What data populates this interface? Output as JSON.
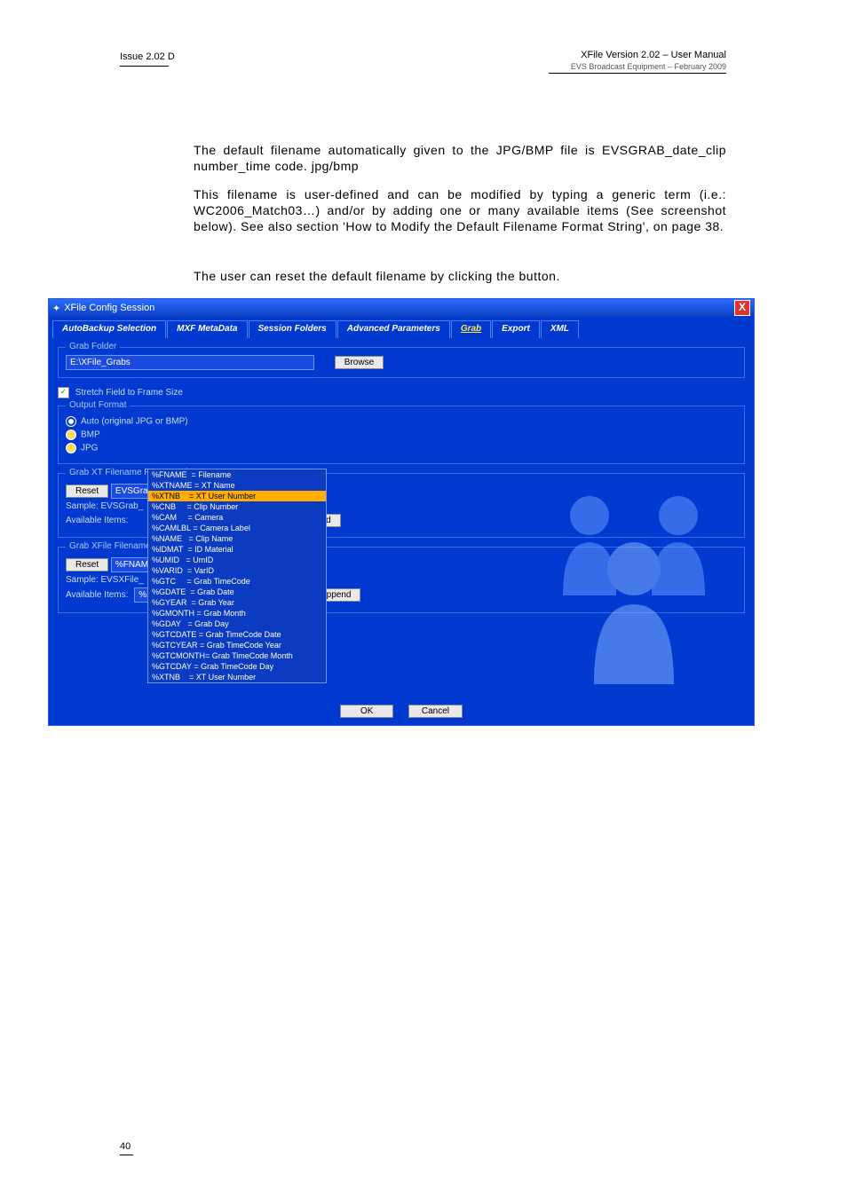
{
  "header": {
    "issue": "Issue 2.02 D",
    "title": "XFile Version 2.02 – User Manual",
    "sub": "EVS Broadcast Equipment – February 2009"
  },
  "para1": "The default filename automatically given to the JPG/BMP file is EVSGRAB_date_clip number_time code. jpg/bmp",
  "para2": "This filename is user-defined and can be modified by typing a generic term (i.e.: WC2006_Match03…) and/or by adding one or many available items (See screenshot below). See also section 'How to Modify the Default Filename Format String', on page 38.",
  "para3": "The user can reset the default filename by clicking the             button.",
  "win": {
    "title": "XFile Config Session",
    "close": "X"
  },
  "tabs": [
    "AutoBackup Selection",
    "MXF MetaData",
    "Session Folders",
    "Advanced Parameters",
    "Grab",
    "Export",
    "XML"
  ],
  "grabFolder": {
    "legend": "Grab Folder",
    "path": "E:\\XFile_Grabs",
    "browse": "Browse"
  },
  "stretch": "Stretch Field to Frame Size",
  "outFmt": {
    "legend": "Output Format",
    "opts": [
      "Auto (original JPG or BMP)",
      "BMP",
      "JPG"
    ]
  },
  "fmt1": {
    "legend": "Grab XT Filename Format String",
    "reset": "Reset",
    "input": "EVSGra",
    "sampleLbl": "Sample: EVSGrab_",
    "availLbl": "Available Items:",
    "append": "Append"
  },
  "fmt2": {
    "legend": "Grab XFile Filename",
    "reset": "Reset",
    "input": "%FNAM",
    "sampleLbl": "Sample: EVSXFile_",
    "availLbl": "Available Items:",
    "sel": "%XTNB",
    "selDesc": "= XT User Number",
    "append": "Append"
  },
  "dropdown": [
    {
      "k": "%FNAME",
      "v": "= Filename"
    },
    {
      "k": "%XTNAME",
      "v": "= XT Name"
    },
    {
      "k": "%XTNB",
      "v": "= XT User Number",
      "hl": true
    },
    {
      "k": "%CNB",
      "v": "= Clip Number"
    },
    {
      "k": "%CAM",
      "v": "= Camera"
    },
    {
      "k": "%CAMLBL",
      "v": "= Camera Label"
    },
    {
      "k": "%NAME",
      "v": "= Clip Name"
    },
    {
      "k": "%IDMAT",
      "v": "= ID Material"
    },
    {
      "k": "%UMID",
      "v": "= UmID"
    },
    {
      "k": "%VARID",
      "v": "= VarID"
    },
    {
      "k": "%GTC",
      "v": "= Grab TimeCode"
    },
    {
      "k": "%GDATE",
      "v": "= Grab Date"
    },
    {
      "k": "%GYEAR",
      "v": "= Grab Year"
    },
    {
      "k": "%GMONTH",
      "v": "= Grab Month"
    },
    {
      "k": "%GDAY",
      "v": "= Grab Day"
    },
    {
      "k": "%GTCDATE",
      "v": "= Grab TimeCode Date"
    },
    {
      "k": "%GTCYEAR",
      "v": "= Grab TimeCode Year"
    },
    {
      "k": "%GTCMONTH",
      "v": "= Grab TimeCode Month"
    },
    {
      "k": "%GTCDAY",
      "v": "= Grab TimeCode Day"
    },
    {
      "k": "%XTNB",
      "v": "= XT User Number"
    }
  ],
  "okBtn": "OK",
  "cancelBtn": "Cancel",
  "pageNum": "40"
}
